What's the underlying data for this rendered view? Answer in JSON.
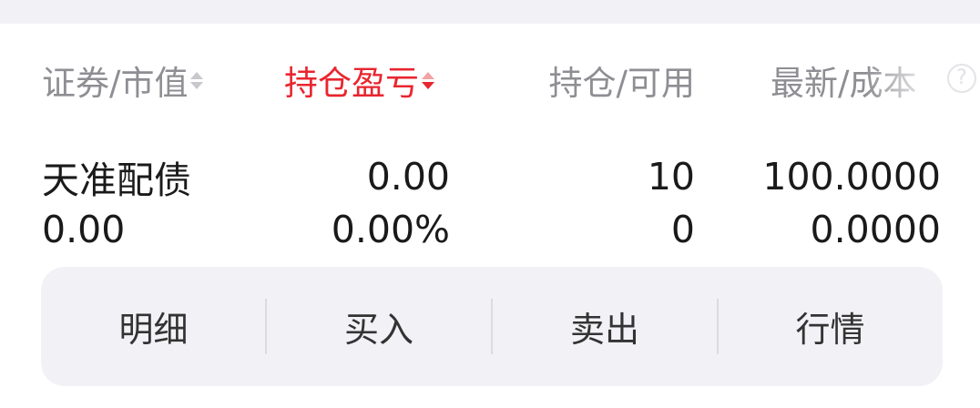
{
  "header": {
    "col1_label": "证券/市值",
    "col2_label": "持仓盈亏",
    "col3_label": "持仓/可用",
    "col4_label": "最新/成本",
    "help_glyph": "?"
  },
  "colors": {
    "active_sort": "#e8262f",
    "header_text": "#8e8e93",
    "action_bar_bg": "#f2f2f6"
  },
  "positions": [
    {
      "name": "天准配债",
      "market_value": "0.00",
      "pnl": "0.00",
      "pnl_ratio": "0.00%",
      "holding": "10",
      "available": "0",
      "latest_price": "100.0000",
      "cost": "0.0000"
    }
  ],
  "actions": [
    {
      "label": "明细",
      "icon": ""
    },
    {
      "label": "买入",
      "icon": ""
    },
    {
      "label": "卖出",
      "icon": ""
    },
    {
      "label": "行情",
      "icon": ""
    }
  ]
}
